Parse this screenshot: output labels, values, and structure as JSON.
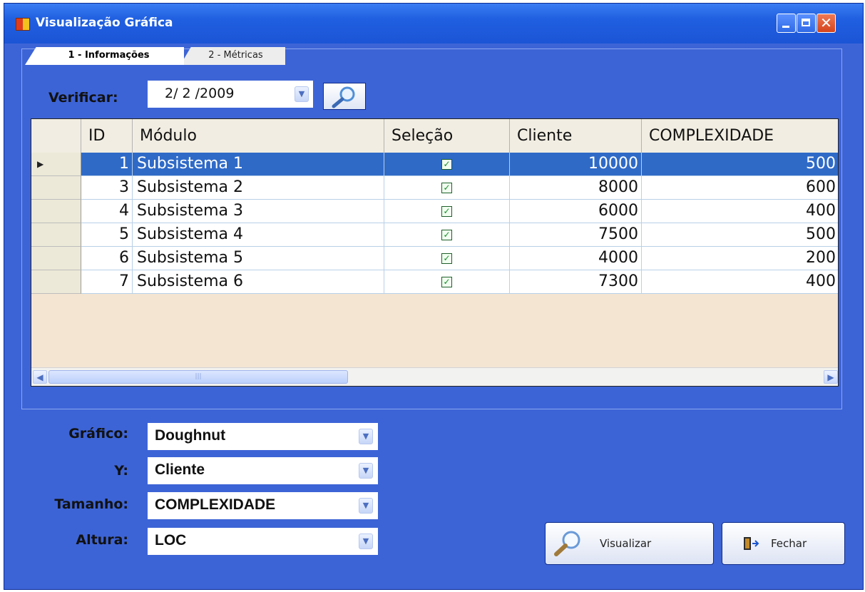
{
  "window": {
    "title": "Visualização Gráfica",
    "buttons": [
      "minimize",
      "maximize",
      "close"
    ]
  },
  "tabs": [
    {
      "label": "1 - Informações",
      "active": true
    },
    {
      "label": "2 - Métricas",
      "active": false
    }
  ],
  "verificar": {
    "label": "Verificar:",
    "value": "2/ 2 /2009"
  },
  "grid": {
    "columns": [
      "ID",
      "Módulo",
      "Seleção",
      "Cliente",
      "COMPLEXIDADE"
    ],
    "rows": [
      {
        "id": "1",
        "modulo": "Subsistema 1",
        "selecao": true,
        "cliente": "10000",
        "complexidade": "500",
        "selected": true
      },
      {
        "id": "3",
        "modulo": "Subsistema 2",
        "selecao": true,
        "cliente": "8000",
        "complexidade": "600"
      },
      {
        "id": "4",
        "modulo": "Subsistema 3",
        "selecao": true,
        "cliente": "6000",
        "complexidade": "400"
      },
      {
        "id": "5",
        "modulo": "Subsistema 4",
        "selecao": true,
        "cliente": "7500",
        "complexidade": "500"
      },
      {
        "id": "6",
        "modulo": "Subsistema 5",
        "selecao": true,
        "cliente": "4000",
        "complexidade": "200"
      },
      {
        "id": "7",
        "modulo": "Subsistema 6",
        "selecao": true,
        "cliente": "7300",
        "complexidade": "400"
      }
    ]
  },
  "fields": {
    "grafico": {
      "label": "Gráfico:",
      "value": "Doughnut"
    },
    "y": {
      "label": "Y:",
      "value": "Cliente"
    },
    "tamanho": {
      "label": "Tamanho:",
      "value": "COMPLEXIDADE"
    },
    "altura": {
      "label": "Altura:",
      "value": "LOC"
    }
  },
  "actions": {
    "visualizar": "Visualizar",
    "fechar": "Fechar"
  },
  "colors": {
    "window_bg": "#3d64d6",
    "selected_row": "#2f6ac7",
    "grid_empty_bg": "#f4e5d3"
  }
}
